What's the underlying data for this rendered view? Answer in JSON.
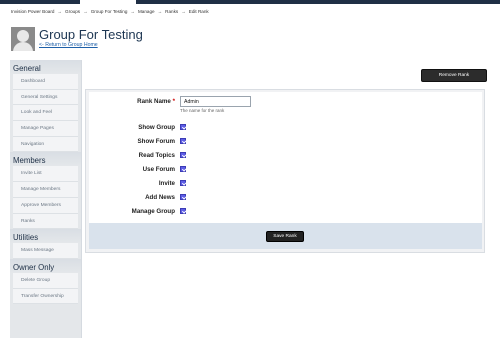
{
  "breadcrumb": [
    "Invision Power Board",
    "Groups",
    "Group For Testing",
    "Manage",
    "Ranks",
    "Edit Rank"
  ],
  "breadcrumb_separator": "→",
  "header": {
    "title": "Group For Testing",
    "return_link": "<- Return to Group Home"
  },
  "sidebar": {
    "general_heading": "General",
    "general_items": [
      "Dashboard",
      "General Settings",
      "Look and Feel",
      "Manage Pages",
      "Navigation"
    ],
    "members_heading": "Members",
    "members_items": [
      "Invite List",
      "Manage Members",
      "Approve Members",
      "Ranks"
    ],
    "utilities_heading": "Utilities",
    "utilities_items": [
      "Mass Message"
    ],
    "owner_heading": "Owner Only",
    "owner_items": [
      "Delete Group",
      "Transfer Ownership"
    ]
  },
  "toolbar": {
    "remove_label": "Remove Rank"
  },
  "form": {
    "rank_name_label": "Rank Name",
    "required_mark": "*",
    "rank_name_value": "Admin",
    "rank_name_hint": "The name for the rank",
    "permissions": [
      {
        "label": "Show Group",
        "checked": true
      },
      {
        "label": "Show Forum",
        "checked": true
      },
      {
        "label": "Read Topics",
        "checked": true
      },
      {
        "label": "Use Forum",
        "checked": true
      },
      {
        "label": "Invite",
        "checked": true
      },
      {
        "label": "Add News",
        "checked": true
      },
      {
        "label": "Manage Group",
        "checked": true
      }
    ],
    "save_label": "Save Rank"
  },
  "colors": {
    "topbar": "#1f2f45",
    "title": "#1d3652",
    "link": "#1d5fa8",
    "checkbox": "#5d5de6",
    "footer": "#d9e2ec"
  }
}
